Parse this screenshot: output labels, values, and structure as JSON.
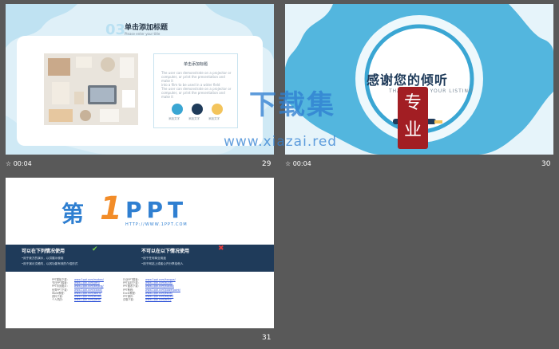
{
  "slides": [
    {
      "number": "29",
      "time": "00:04",
      "badge": "03",
      "title": "单击添加标题",
      "subtitle": "Please enter your title",
      "card_title": "单击添加标题",
      "card_text": [
        "The user can demonstrate on a projector or",
        "computer, or print the presentation and make it",
        "into a film to be used in a wider field",
        "The user can demonstrate on a projector or",
        "computer, or print the presentation and make it"
      ],
      "buttons": [
        "添加文字",
        "添加文字",
        "添加文字"
      ]
    },
    {
      "number": "30",
      "time": "00:04",
      "title": "感谢您的倾听",
      "subtitle": "THANKS FOR YOUR LISTING",
      "watermark_main": "下载集",
      "watermark_url": "www.xiazai.red",
      "seal_text": "专业"
    },
    {
      "number": "31",
      "logo_word": "第",
      "logo_one": "1",
      "logo_ppt": "PPT",
      "logo_url": "HTTP://WWW.1PPT.COM",
      "allowed_title": "可以在下列情况使用",
      "allowed_items": [
        "•用于我方的演示，以供展示使用",
        "•用于演示文稿内，以其功能有效的介绍形式"
      ],
      "forbidden_title": "不可以在以下情况使用",
      "forbidden_items": [
        "•用于任何商业用途",
        "•用于网站上或者公开分享给他人"
      ],
      "links_left_labels": [
        "PPT模板下载：",
        "节日PPT模板：",
        "PPT背景图片：",
        "优秀PPT下载：",
        "Word教程：",
        "资料下载：",
        "个人简历："
      ],
      "links_left": [
        "www.1ppt.com/moban/",
        "www.1ppt.com/jieri/",
        "www.1ppt.com/beijing/",
        "www.1ppt.com/xiazai/",
        "www.1ppt.com/word/",
        "www.1ppt.com/ziliao/",
        "www.1ppt.com/jianli/"
      ],
      "links_right_labels": [
        "行业PPT模板：",
        "PPT素材下载：",
        "PPT图表下载：",
        "PPT教程：",
        "Excel教程：",
        "PPT课件：",
        "试卷下载："
      ],
      "links_right": [
        "www.1ppt.com/hangye/",
        "www.1ppt.com/sucai/",
        "www.1ppt.com/tubiao/",
        "www.1ppt.com/powerpoint/",
        "www.1ppt.com/excel/",
        "www.1ppt.com/kejian/",
        "www.1ppt.com/shiti/"
      ]
    }
  ],
  "colors": {
    "accent": "#3aa6d3",
    "navy": "#1f3b5a",
    "blue": "#2f7fd1",
    "orange": "#f28c28",
    "red": "#a21e23"
  }
}
